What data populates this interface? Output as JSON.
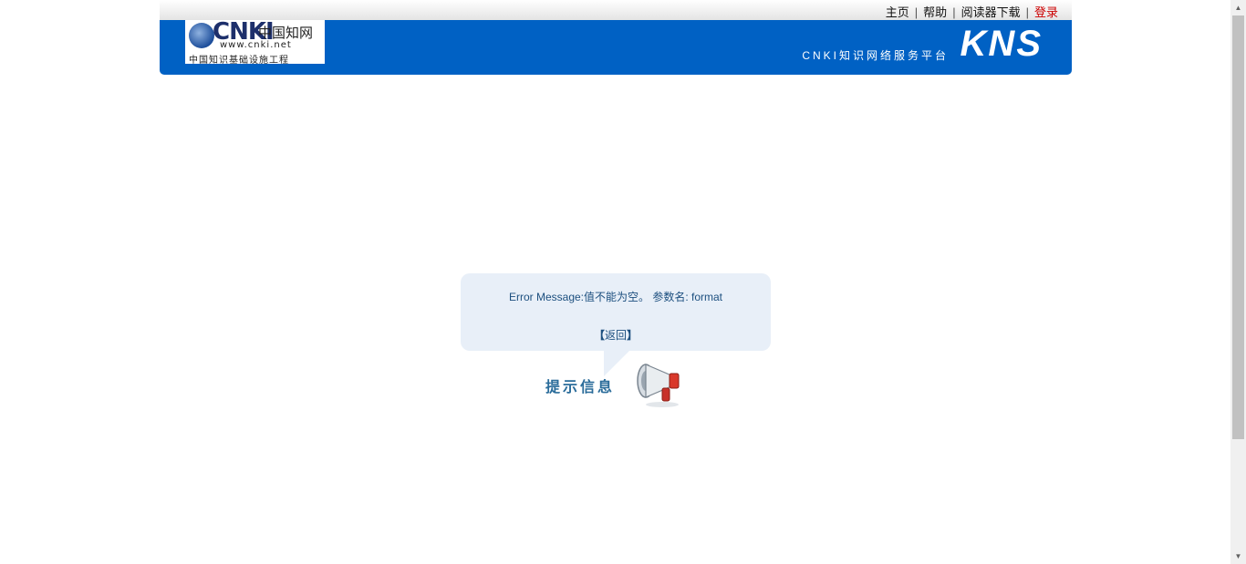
{
  "nav": {
    "links": [
      "主页",
      "帮助",
      "阅读器下载"
    ],
    "login": "登录"
  },
  "logo": {
    "brand": "CNKI",
    "brand_cn": "中国知网",
    "url": "www.cnki.net",
    "subtitle": "中国知识基础设施工程"
  },
  "header": {
    "platform": "CNKI知识网络服务平台",
    "product": "KNS"
  },
  "message": {
    "error_text": "Error Message:值不能为空。 参数名: format",
    "back_open": "【",
    "back_label": "返回",
    "back_close": "】",
    "tip_label": "提示信息"
  },
  "colors": {
    "banner": "#0061c4",
    "message_bg": "#e8eff8",
    "message_text": "#1c4f7f",
    "login": "#cc0000"
  },
  "icons": {
    "logo_globe": "globe-icon",
    "megaphone": "megaphone-icon"
  }
}
